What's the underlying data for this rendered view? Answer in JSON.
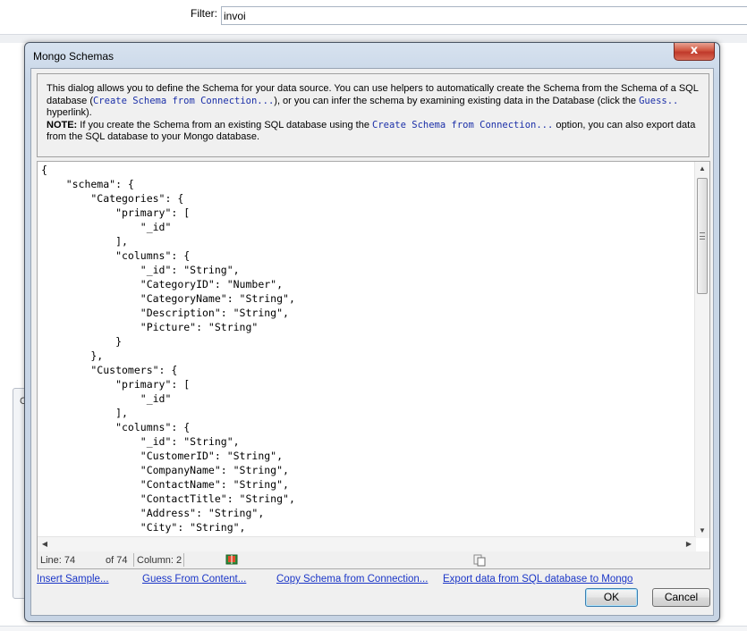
{
  "background": {
    "filter_label": "Filter:",
    "filter_value": "invoi",
    "side_panel_char": "C"
  },
  "dialog": {
    "title": "Mongo Schemas",
    "close_label": "x",
    "info": {
      "line1_a": "This dialog allows you to define the Schema for your data source. You can use helpers to automatically create the Schema from the Schema of a SQL database (",
      "line1_code": "Create Schema from Connection...",
      "line1_b": "), or you can infer the schema by examining existing data in the Database (click the ",
      "guess_code": "Guess..",
      "line1_c": " hyperlink).",
      "note_label": "NOTE:",
      "note_a": " If you create the Schema from an existing SQL database using the ",
      "note_code": "Create Schema from Connection...",
      "note_b": " option, you can also export data from the SQL database to your Mongo database."
    },
    "editor": {
      "lines": [
        "{",
        "    \"schema\": {",
        "        \"Categories\": {",
        "            \"primary\": [",
        "                \"_id\"",
        "            ],",
        "            \"columns\": {",
        "                \"_id\": \"String\",",
        "                \"CategoryID\": \"Number\",",
        "                \"CategoryName\": \"String\",",
        "                \"Description\": \"String\",",
        "                \"Picture\": \"String\"",
        "            }",
        "        },",
        "        \"Customers\": {",
        "            \"primary\": [",
        "                \"_id\"",
        "            ],",
        "            \"columns\": {",
        "                \"_id\": \"String\",",
        "                \"CustomerID\": \"String\",",
        "                \"CompanyName\": \"String\",",
        "                \"ContactName\": \"String\",",
        "                \"ContactTitle\": \"String\",",
        "                \"Address\": \"String\",",
        "                \"City\": \"String\","
      ]
    },
    "status": {
      "line": "Line: 74",
      "of": "of 74",
      "column": "Column: 2"
    },
    "links": {
      "insert_sample": "Insert Sample...",
      "guess_from_content": "Guess From Content...",
      "copy_schema": "Copy Schema from Connection...",
      "export_data": "Export data from SQL database to Mongo"
    },
    "buttons": {
      "ok": "OK",
      "cancel": "Cancel"
    }
  }
}
